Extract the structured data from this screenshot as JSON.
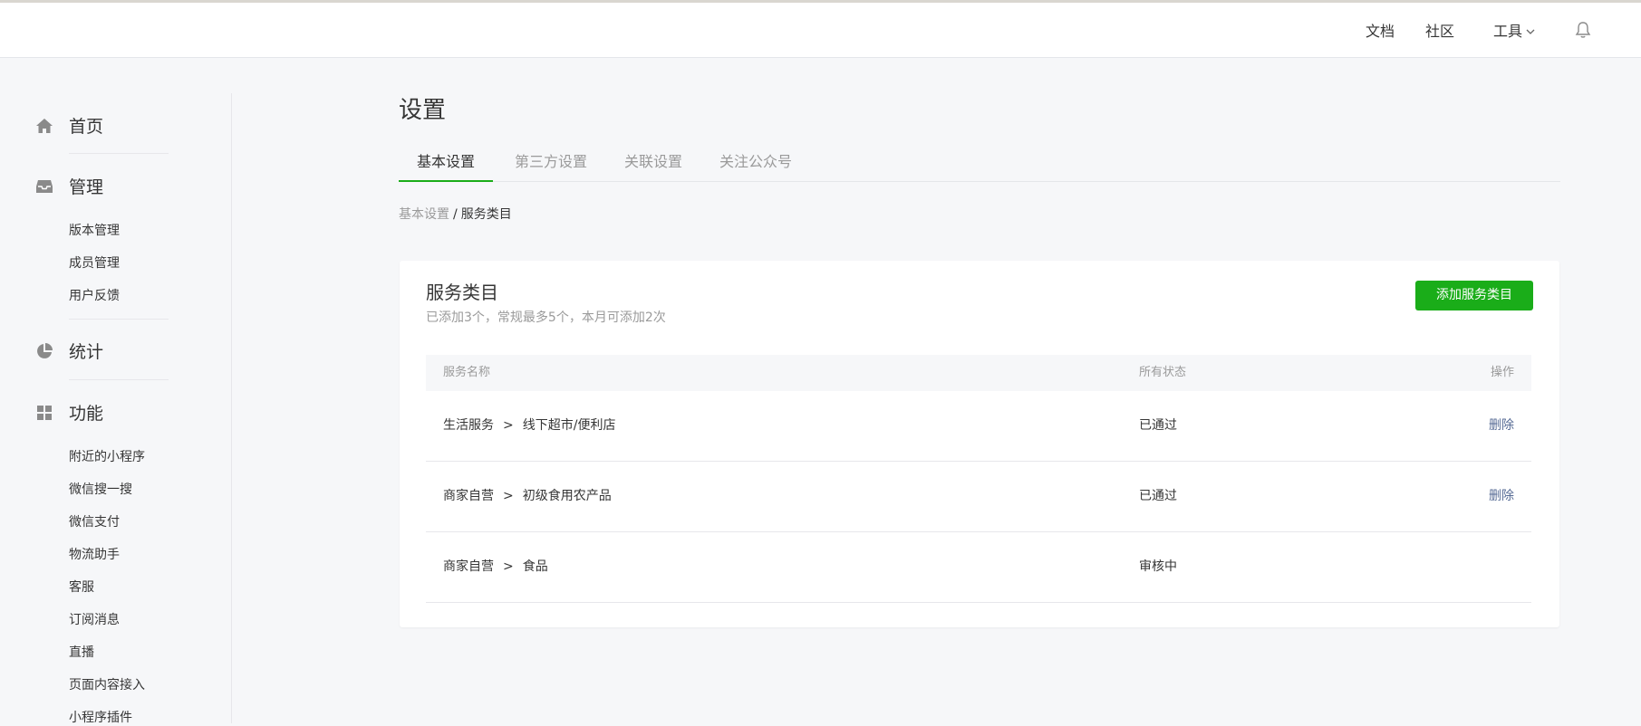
{
  "topnav": {
    "docs": "文档",
    "community": "社区",
    "tools": "工具",
    "tools_icon": "chevron-down-icon",
    "bell_icon": "bell-icon"
  },
  "sidebar": {
    "groups": [
      {
        "label": "首页",
        "icon": "home-icon",
        "items": []
      },
      {
        "label": "管理",
        "icon": "inbox-icon",
        "items": [
          "版本管理",
          "成员管理",
          "用户反馈"
        ]
      },
      {
        "label": "统计",
        "icon": "pie-chart-icon",
        "items": []
      },
      {
        "label": "功能",
        "icon": "grid-icon",
        "items": [
          "附近的小程序",
          "微信搜一搜",
          "微信支付",
          "物流助手",
          "客服",
          "订阅消息",
          "直播",
          "页面内容接入",
          "小程序插件"
        ]
      }
    ]
  },
  "page": {
    "title": "设置",
    "tabs": [
      "基本设置",
      "第三方设置",
      "关联设置",
      "关注公众号"
    ],
    "active_tab": "基本设置",
    "breadcrumb": {
      "parent": "基本设置",
      "separator": "/",
      "current": "服务类目"
    }
  },
  "card": {
    "title": "服务类目",
    "subtitle": "已添加3个，常规最多5个，本月可添加2次",
    "add_button": "添加服务类目",
    "table": {
      "headers": {
        "name": "服务名称",
        "status": "所有状态",
        "action": "操作"
      },
      "rows": [
        {
          "category": "生活服务",
          "arrow": ">",
          "subcategory": "线下超市/便利店",
          "status": "已通过",
          "action": "删除"
        },
        {
          "category": "商家自营",
          "arrow": ">",
          "subcategory": "初级食用农产品",
          "status": "已通过",
          "action": "删除"
        },
        {
          "category": "商家自营",
          "arrow": ">",
          "subcategory": "食品",
          "status": "审核中",
          "action": ""
        }
      ]
    }
  },
  "colors": {
    "accent": "#1aad19",
    "link": "#576b95",
    "text": "#353535",
    "muted": "#9a9a9a",
    "background": "#f6f7f9"
  }
}
